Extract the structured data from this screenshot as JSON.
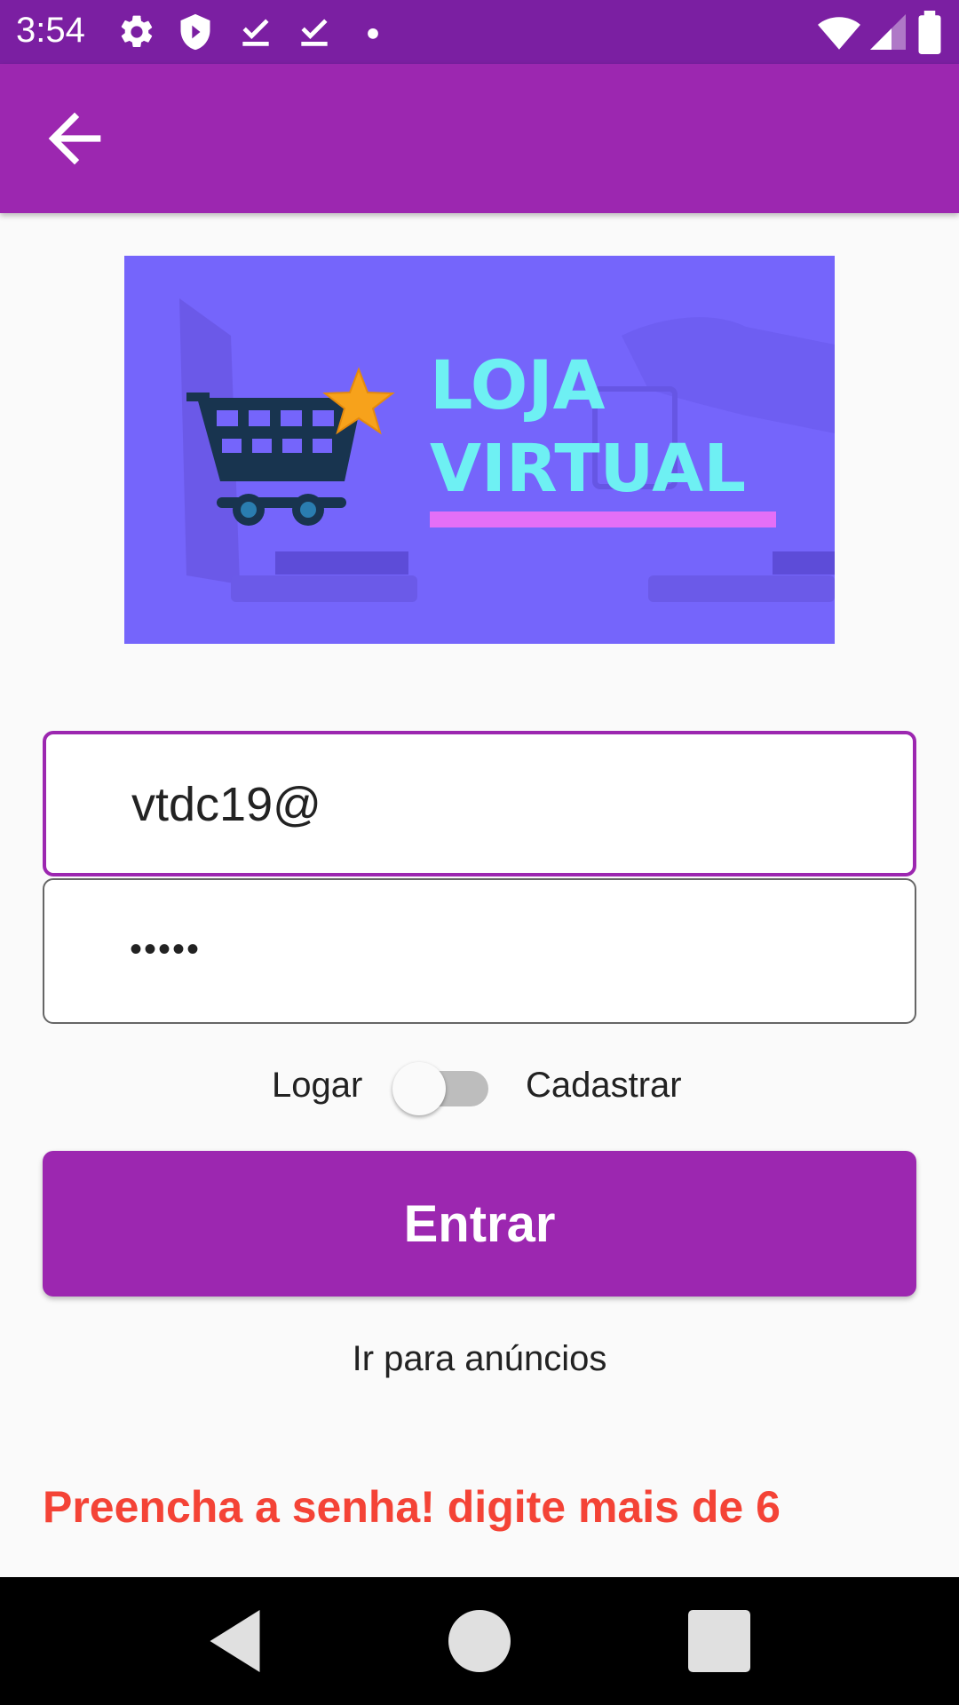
{
  "status_bar": {
    "time": "3:54",
    "left_icons": [
      "gear-icon",
      "shield-icon",
      "download-done-icon",
      "download-done-icon",
      "dot-icon"
    ],
    "right_icons": [
      "wifi-icon",
      "cell-signal-icon",
      "battery-icon"
    ]
  },
  "app_bar": {
    "back_icon": "arrow-left-icon",
    "color": "#9c27b0"
  },
  "banner": {
    "logo_line1": "LOJA",
    "logo_line2": "VIRTUAL"
  },
  "form": {
    "email_value": "vtdc19@",
    "password_value": "•••••",
    "toggle_left_label": "Logar",
    "toggle_right_label": "Cadastrar",
    "toggle_on": false,
    "submit_label": "Entrar",
    "ads_link_label": "Ir para anúncios",
    "error_message": "Preencha a senha! digite mais de 6"
  },
  "colors": {
    "primary": "#9c27b0",
    "primary_dark": "#7b1fa2",
    "error": "#f44336",
    "banner_bg": "#7565fb",
    "logo_text": "#6ef0f3",
    "logo_underline": "#e46ff7"
  },
  "nav_bar": {
    "icons": [
      "back-triangle-icon",
      "home-circle-icon",
      "recents-square-icon"
    ]
  }
}
